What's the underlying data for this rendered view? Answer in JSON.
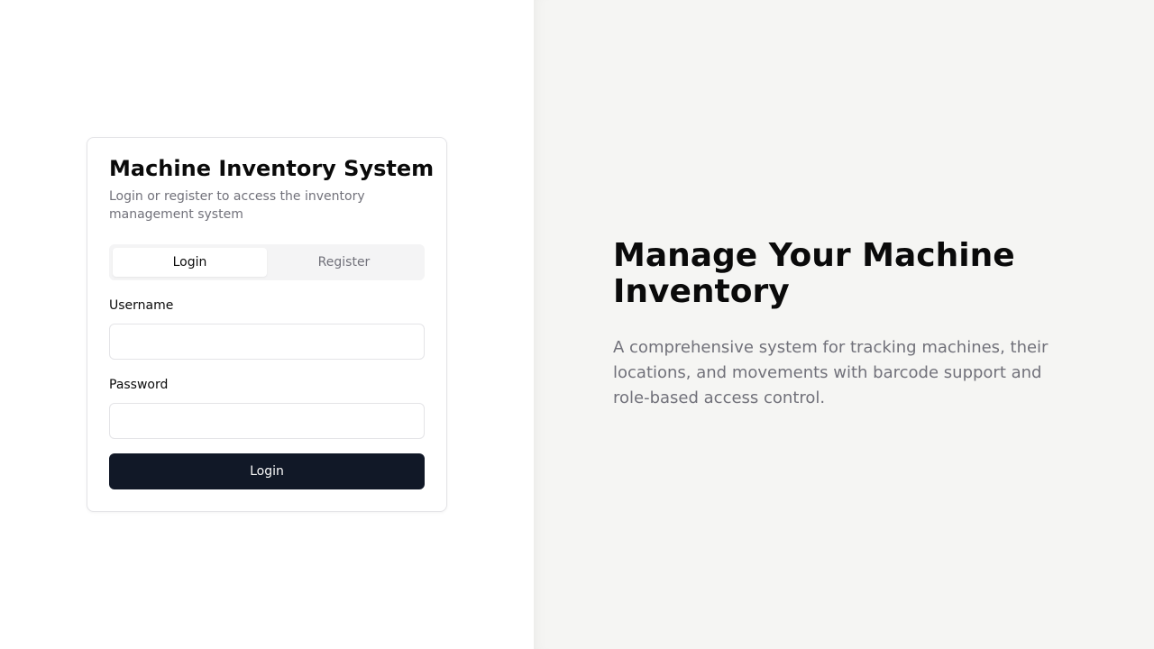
{
  "login_card": {
    "title": "Machine Inventory System",
    "subtitle": "Login or register to access the inventory management system",
    "tabs": [
      {
        "label": "Login",
        "active": true
      },
      {
        "label": "Register",
        "active": false
      }
    ],
    "username": {
      "label": "Username",
      "value": "",
      "placeholder": ""
    },
    "password": {
      "label": "Password",
      "value": "",
      "placeholder": ""
    },
    "submit_label": "Login"
  },
  "hero": {
    "title": "Manage Your Machine Inventory",
    "description": "A comprehensive system for tracking machines, their locations, and movements with barcode support and role-based access control."
  },
  "colors": {
    "primary_button": "#111827",
    "right_panel_bg": "#f5f5f3",
    "muted_text": "#71717a",
    "border": "#e4e4e7"
  }
}
